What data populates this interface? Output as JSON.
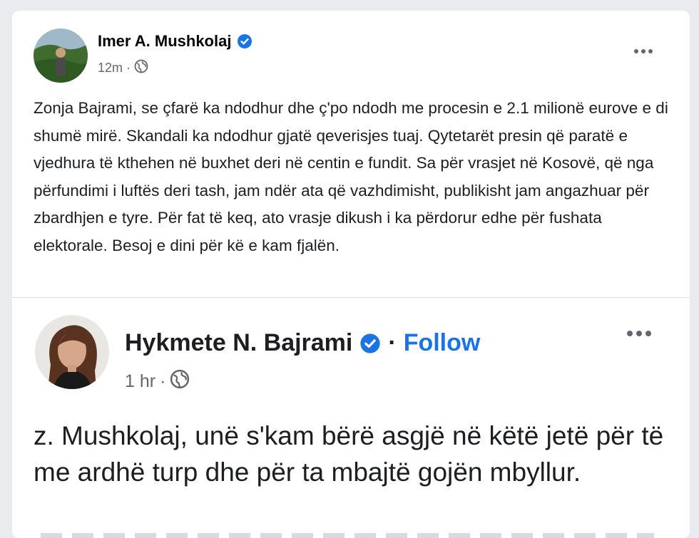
{
  "post": {
    "author": "Imer A. Mushkolaj",
    "time": "12m",
    "time_separator": "·",
    "privacy_icon": "globe-icon",
    "text": "Zonja Bajrami, se çfarë ka ndodhur dhe ç'po ndodh me procesin e 2.1 milionë eurove e di shumë mirë. Skandali ka ndodhur gjatë qeverisjes tuaj. Qytetarët presin që paratë e vjedhura të kthehen në buxhet deri në centin e fundit. Sa për vrasjet në Kosovë, që nga përfundimi i luftës deri tash, jam ndër ata që vazhdimisht, publikisht jam angazhuar për zbardhjen e tyre. Për fat të keq, ato vrasje dikush i ka përdorur edhe për fushata elektorale. Besoj e dini për kë e kam fjalën."
  },
  "shared_post": {
    "author": "Hykmete N. Bajrami",
    "separator": "·",
    "follow_label": "Follow",
    "time": "1 hr",
    "time_separator": "·",
    "privacy_icon": "globe-icon",
    "text": "z. Mushkolaj, unë s'kam bërë asgjë në këtë jetë për të me ardhë turp dhe për ta mbajtë gojën mbyllur."
  },
  "colors": {
    "background": "#e9ebee",
    "card": "#ffffff",
    "verified": "#1b74e4",
    "link": "#1b74e4",
    "muted": "#65676b"
  }
}
